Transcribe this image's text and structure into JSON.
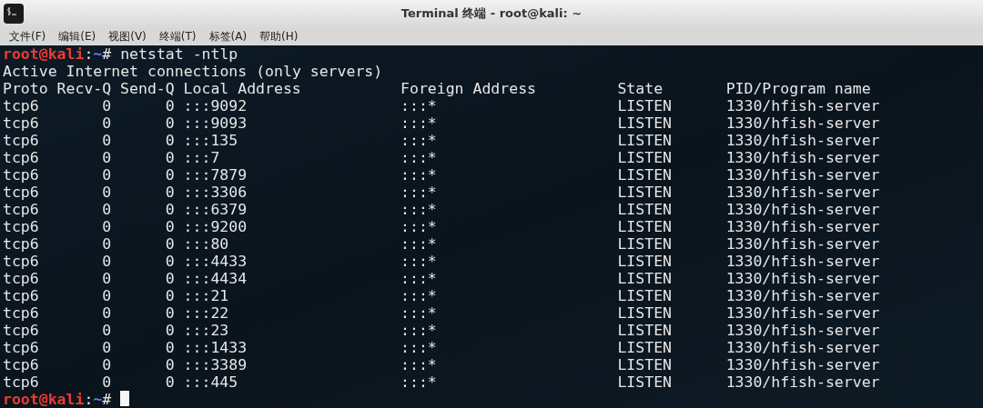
{
  "window": {
    "title": "Terminal 终端 - root@kali: ~"
  },
  "menu": [
    "文件(F)",
    "编辑(E)",
    "视图(V)",
    "终端(T)",
    "标签(A)",
    "帮助(H)"
  ],
  "terminal": {
    "command_prompt": {
      "user": "root@kali",
      "separator": ":",
      "path": "~",
      "symbol": "#",
      "command": "netstat -ntlp",
      "cursor": false
    },
    "output_title": "Active Internet connections (only servers)",
    "columns": [
      "Proto",
      "Recv-Q",
      "Send-Q",
      "Local Address",
      "Foreign Address",
      "State",
      "PID/Program name"
    ],
    "rows": [
      [
        "tcp6",
        "0",
        "0",
        ":::9092",
        ":::*",
        "LISTEN",
        "1330/hfish-server"
      ],
      [
        "tcp6",
        "0",
        "0",
        ":::9093",
        ":::*",
        "LISTEN",
        "1330/hfish-server"
      ],
      [
        "tcp6",
        "0",
        "0",
        ":::135",
        ":::*",
        "LISTEN",
        "1330/hfish-server"
      ],
      [
        "tcp6",
        "0",
        "0",
        ":::7",
        ":::*",
        "LISTEN",
        "1330/hfish-server"
      ],
      [
        "tcp6",
        "0",
        "0",
        ":::7879",
        ":::*",
        "LISTEN",
        "1330/hfish-server"
      ],
      [
        "tcp6",
        "0",
        "0",
        ":::3306",
        ":::*",
        "LISTEN",
        "1330/hfish-server"
      ],
      [
        "tcp6",
        "0",
        "0",
        ":::6379",
        ":::*",
        "LISTEN",
        "1330/hfish-server"
      ],
      [
        "tcp6",
        "0",
        "0",
        ":::9200",
        ":::*",
        "LISTEN",
        "1330/hfish-server"
      ],
      [
        "tcp6",
        "0",
        "0",
        ":::80",
        ":::*",
        "LISTEN",
        "1330/hfish-server"
      ],
      [
        "tcp6",
        "0",
        "0",
        ":::4433",
        ":::*",
        "LISTEN",
        "1330/hfish-server"
      ],
      [
        "tcp6",
        "0",
        "0",
        ":::4434",
        ":::*",
        "LISTEN",
        "1330/hfish-server"
      ],
      [
        "tcp6",
        "0",
        "0",
        ":::21",
        ":::*",
        "LISTEN",
        "1330/hfish-server"
      ],
      [
        "tcp6",
        "0",
        "0",
        ":::22",
        ":::*",
        "LISTEN",
        "1330/hfish-server"
      ],
      [
        "tcp6",
        "0",
        "0",
        ":::23",
        ":::*",
        "LISTEN",
        "1330/hfish-server"
      ],
      [
        "tcp6",
        "0",
        "0",
        ":::1433",
        ":::*",
        "LISTEN",
        "1330/hfish-server"
      ],
      [
        "tcp6",
        "0",
        "0",
        ":::3389",
        ":::*",
        "LISTEN",
        "1330/hfish-server"
      ],
      [
        "tcp6",
        "0",
        "0",
        ":::445",
        ":::*",
        "LISTEN",
        "1330/hfish-server"
      ]
    ],
    "final_prompt": {
      "user": "root@kali",
      "separator": ":",
      "path": "~",
      "symbol": "#",
      "cursor": true
    }
  }
}
